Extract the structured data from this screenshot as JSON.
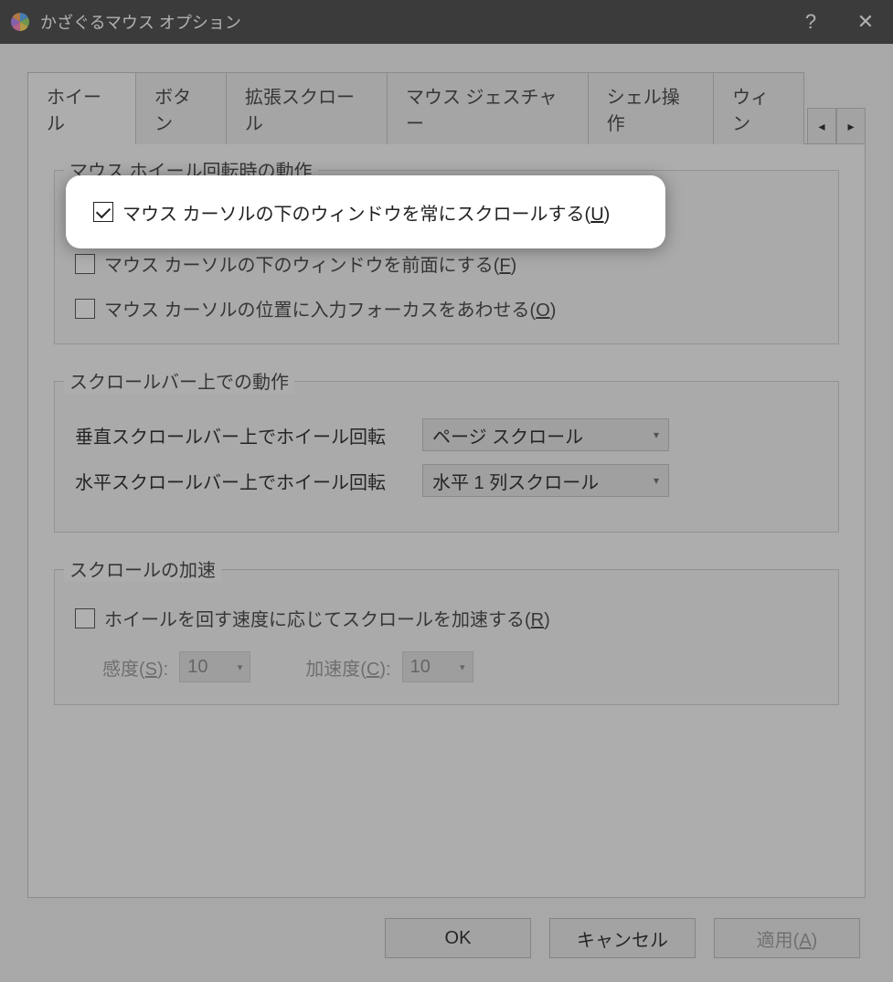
{
  "window": {
    "title": "かざぐるマウス オプション"
  },
  "tabs": {
    "items": [
      "ホイール",
      "ボタン",
      "拡張スクロール",
      "マウス ジェスチャー",
      "シェル操作",
      "ウィン"
    ],
    "active_index": 0,
    "arrow_left": "◂",
    "arrow_right": "▸"
  },
  "group1": {
    "legend": "マウス ホイール回転時の動作",
    "chk1": {
      "label_pre": "マウス カーソルの下のウィンドウを常にスクロールする(",
      "accel": "U",
      "label_post": ")",
      "checked": true
    },
    "chk2": {
      "label_pre": "マウス カーソルの下のウィンドウを前面にする(",
      "accel": "F",
      "label_post": ")",
      "checked": false
    },
    "chk3": {
      "label_pre": "マウス カーソルの位置に入力フォーカスをあわせる(",
      "accel": "O",
      "label_post": ")",
      "checked": false
    }
  },
  "group2": {
    "legend": "スクロールバー上での動作",
    "row1": {
      "label": "垂直スクロールバー上でホイール回転",
      "value": "ページ スクロール"
    },
    "row2": {
      "label": "水平スクロールバー上でホイール回転",
      "value": "水平 1 列スクロール"
    }
  },
  "group3": {
    "legend": "スクロールの加速",
    "chk": {
      "label_pre": "ホイールを回す速度に応じてスクロールを加速する(",
      "accel": "R",
      "label_post": ")",
      "checked": false
    },
    "sens": {
      "label_pre": "感度(",
      "accel": "S",
      "label_post": "):",
      "value": "10"
    },
    "accel": {
      "label_pre": "加速度(",
      "accel": "C",
      "label_post": "):",
      "value": "10"
    }
  },
  "footer": {
    "ok": "OK",
    "cancel": "キャンセル",
    "apply_pre": "適用(",
    "apply_accel": "A",
    "apply_post": ")"
  },
  "titlebar": {
    "help": "?",
    "close": "✕"
  }
}
